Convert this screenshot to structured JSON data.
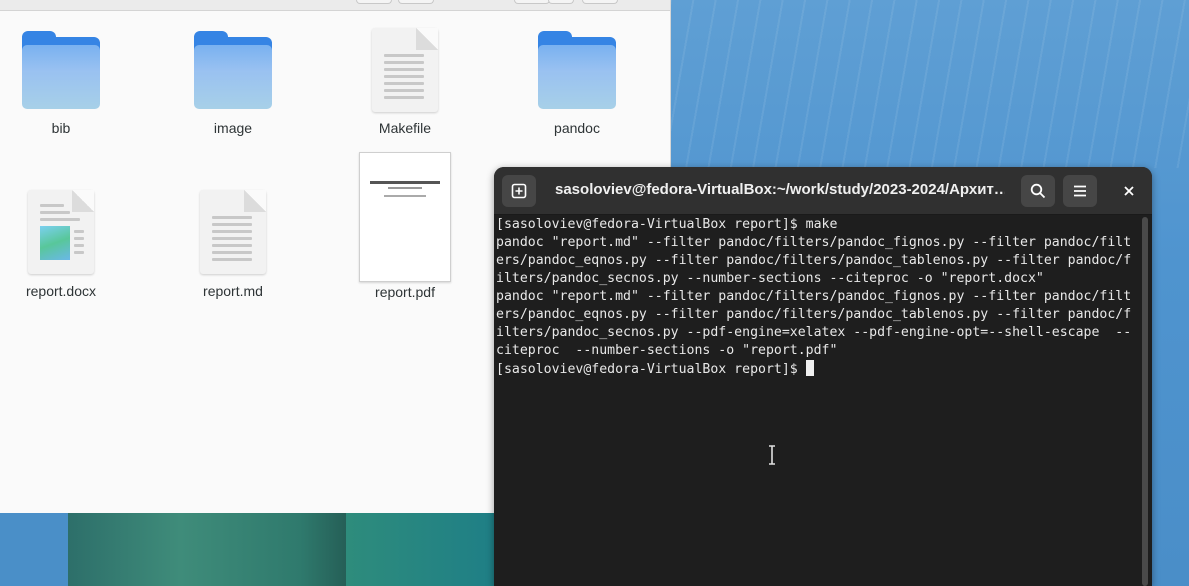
{
  "files": {
    "items": [
      {
        "name": "bib",
        "kind": "folder"
      },
      {
        "name": "image",
        "kind": "folder"
      },
      {
        "name": "Makefile",
        "kind": "text"
      },
      {
        "name": "pandoc",
        "kind": "folder"
      },
      {
        "name": "report.docx",
        "kind": "docx"
      },
      {
        "name": "report.md",
        "kind": "text"
      },
      {
        "name": "report.pdf",
        "kind": "pdf"
      }
    ],
    "pdf_thumb_title": "Шаблон отчёта по лабораторной работе"
  },
  "terminal": {
    "title": "sasoloviev@fedora-VirtualBox:~/work/study/2023-2024/Архит…",
    "new_tab_icon": "new-tab-icon",
    "search_icon": "search-icon",
    "menu_icon": "hamburger-menu-icon",
    "close_icon": "close-icon",
    "lines": [
      "[sasoloviev@fedora-VirtualBox report]$ make",
      "pandoc \"report.md\" --filter pandoc/filters/pandoc_fignos.py --filter pandoc/filt",
      "ers/pandoc_eqnos.py --filter pandoc/filters/pandoc_tablenos.py --filter pandoc/f",
      "ilters/pandoc_secnos.py --number-sections --citeproc -o \"report.docx\"",
      "pandoc \"report.md\" --filter pandoc/filters/pandoc_fignos.py --filter pandoc/filt",
      "ers/pandoc_eqnos.py --filter pandoc/filters/pandoc_tablenos.py --filter pandoc/f",
      "ilters/pandoc_secnos.py --pdf-engine=xelatex --pdf-engine-opt=--shell-escape  --",
      "citeproc  --number-sections -o \"report.pdf\""
    ],
    "prompt": "[sasoloviev@fedora-VirtualBox report]$ "
  },
  "colors": {
    "folder_blue": "#3584e4",
    "terminal_bg": "#1e1e1e",
    "terminal_header": "#303030"
  }
}
